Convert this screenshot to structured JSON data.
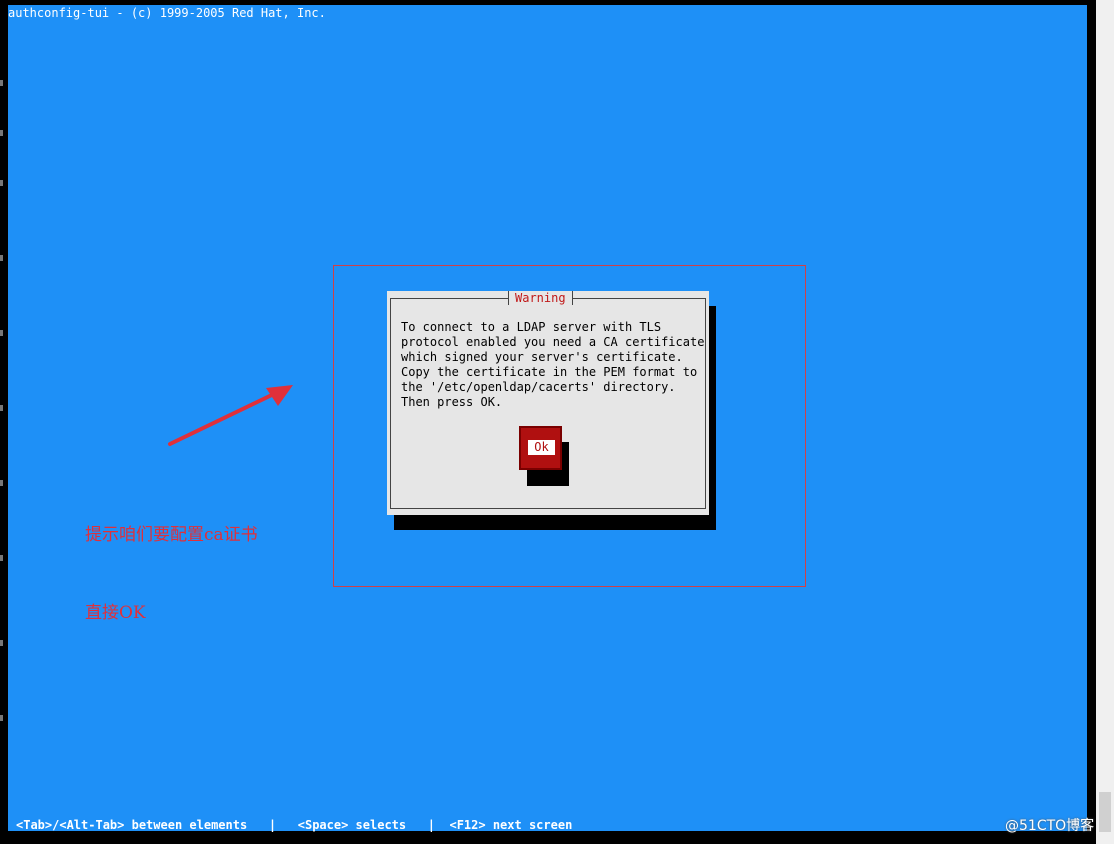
{
  "window": {
    "title_line": "authconfig-tui - (c) 1999-2005 Red Hat, Inc."
  },
  "dialog": {
    "title": "Warning",
    "message": "To connect to a LDAP server with TLS\nprotocol enabled you need a CA certificate\nwhich signed your server's certificate.\nCopy the certificate in the PEM format to\nthe '/etc/openldap/cacerts' directory.\nThen press OK.",
    "ok_label": "Ok"
  },
  "annotation": {
    "line1": "提示咱们要配置ca证书",
    "line2": "直接OK"
  },
  "status_bar": {
    "text": "<Tab>/<Alt-Tab> between elements   |   <Space> selects   |  <F12> next screen"
  },
  "watermark": {
    "text": "@51CTO博客"
  },
  "colors": {
    "screen_bg": "#1e90f7",
    "dialog_bg": "#e6e6e6",
    "button_red": "#b01010",
    "annotation_red": "#e0303a"
  }
}
